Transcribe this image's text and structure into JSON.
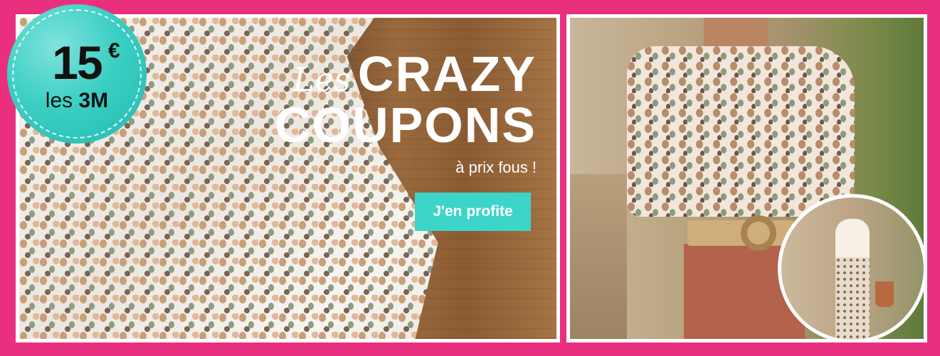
{
  "banner": {
    "badge": {
      "price": "15",
      "currency": "€",
      "unit_prefix": "les",
      "unit_bold": "3M"
    },
    "headline": {
      "les": "Les",
      "line1": "CRAZY",
      "line2": "COUPONS",
      "sub": "à prix fous !"
    },
    "cta_label": "J'en profite"
  },
  "colors": {
    "background": "#e9307f",
    "accent": "#3dd5c9"
  },
  "images": {
    "left": "fabric-dotted-print-on-wood",
    "right": "woman-dotted-blouse-belt",
    "inset": "woman-dotted-wide-pants"
  }
}
